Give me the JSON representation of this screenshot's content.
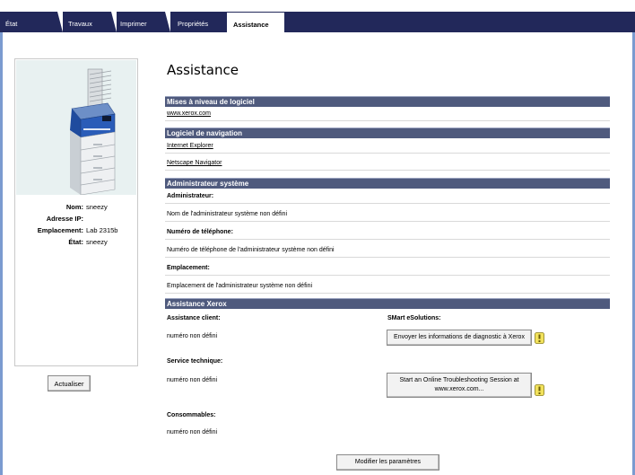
{
  "tabs": [
    {
      "label": "État"
    },
    {
      "label": "Travaux"
    },
    {
      "label": "Imprimer"
    },
    {
      "label": "Propriétés"
    },
    {
      "label": "Assistance"
    }
  ],
  "active_tab": "Assistance",
  "device": {
    "name_label": "Nom:",
    "name_value": "sneezy",
    "ip_label": "Adresse IP:",
    "ip_value": "",
    "location_label": "Emplacement:",
    "location_value": "Lab 2315b",
    "state_label": "État:",
    "state_value": "sneezy",
    "refresh_label": "Actualiser"
  },
  "page_title": "Assistance",
  "sections": {
    "upgrades": {
      "header": "Mises à niveau de logiciel",
      "link": "www.xerox.com"
    },
    "browsers": {
      "header": "Logiciel de navigation",
      "links": [
        "Internet Explorer",
        "Netscape Navigator"
      ]
    },
    "admin": {
      "header": "Administrateur système",
      "admin_label": "Administrateur:",
      "admin_value": "Nom de l'administrateur système non défini",
      "phone_label": "Numéro de téléphone:",
      "phone_value": "Numéro de téléphone de l'administrateur système non défini",
      "location_label": "Emplacement:",
      "location_value": "Emplacement de l'administrateur système non défini"
    },
    "xerox": {
      "header": "Assistance Xerox",
      "client_label": "Assistance client:",
      "client_value": "numéro non défini",
      "tech_label": "Service technique:",
      "tech_value": "numéro non défini",
      "supplies_label": "Consommables:",
      "supplies_value": "numéro non défini",
      "smart_label": "SMart eSolutions:",
      "diag_button": "Envoyer les informations de diagnostic à Xerox",
      "trouble_button_line1": "Start an Online Troubleshooting Session at",
      "trouble_button_line2": "www.xerox.com..."
    }
  },
  "modify_button": "Modifier les paramètres",
  "colors": {
    "tab_strip": "#22285a",
    "section_header": "#4f5a7d",
    "frame_border": "#7b9bd0",
    "printer_bg": "#e8f1f1",
    "info_icon": "#f2e25c"
  }
}
